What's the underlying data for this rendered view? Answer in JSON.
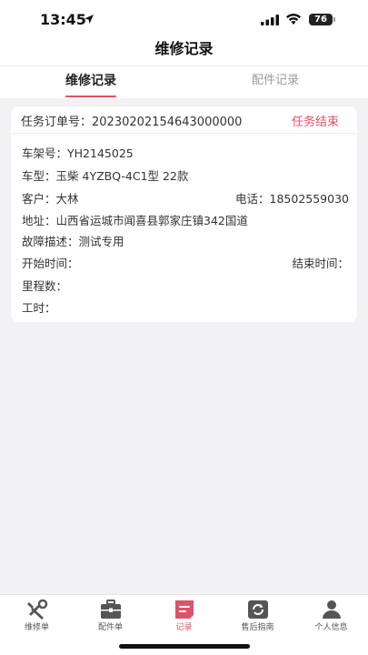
{
  "status_bar": {
    "time": "13:45",
    "battery": "76"
  },
  "header": {
    "title": "维修记录"
  },
  "tabs": [
    {
      "label": "维修记录"
    },
    {
      "label": "配件记录"
    }
  ],
  "record": {
    "order_label": "任务订单号：",
    "order_no": "20230202154643000000",
    "status": "任务结束",
    "frame_label": "车架号：",
    "frame_no": "YH2145025",
    "model_label": "车型：",
    "model": "玉柴 4YZBQ-4C1型 22款",
    "customer_label": "客户：",
    "customer": "大林",
    "phone_label": "电话：",
    "phone": "18502559030",
    "address_label": "地址：",
    "address": "山西省运城市闻喜县郭家庄镇342国道",
    "fault_label": "故障描述：",
    "fault": "测试专用",
    "start_label": "开始时间：",
    "end_label": "结束时间：",
    "mileage_label": "里程数：",
    "hours_label": "工时："
  },
  "tabbar": {
    "items": [
      {
        "label": "维修单",
        "icon": "tools-icon"
      },
      {
        "label": "配件单",
        "icon": "briefcase-icon"
      },
      {
        "label": "记录",
        "icon": "record-icon",
        "active": true
      },
      {
        "label": "售后指南",
        "icon": "guide-icon"
      },
      {
        "label": "个人信息",
        "icon": "person-icon"
      }
    ]
  },
  "colors": {
    "accent": "#e25067",
    "background": "#f2f2f5"
  }
}
